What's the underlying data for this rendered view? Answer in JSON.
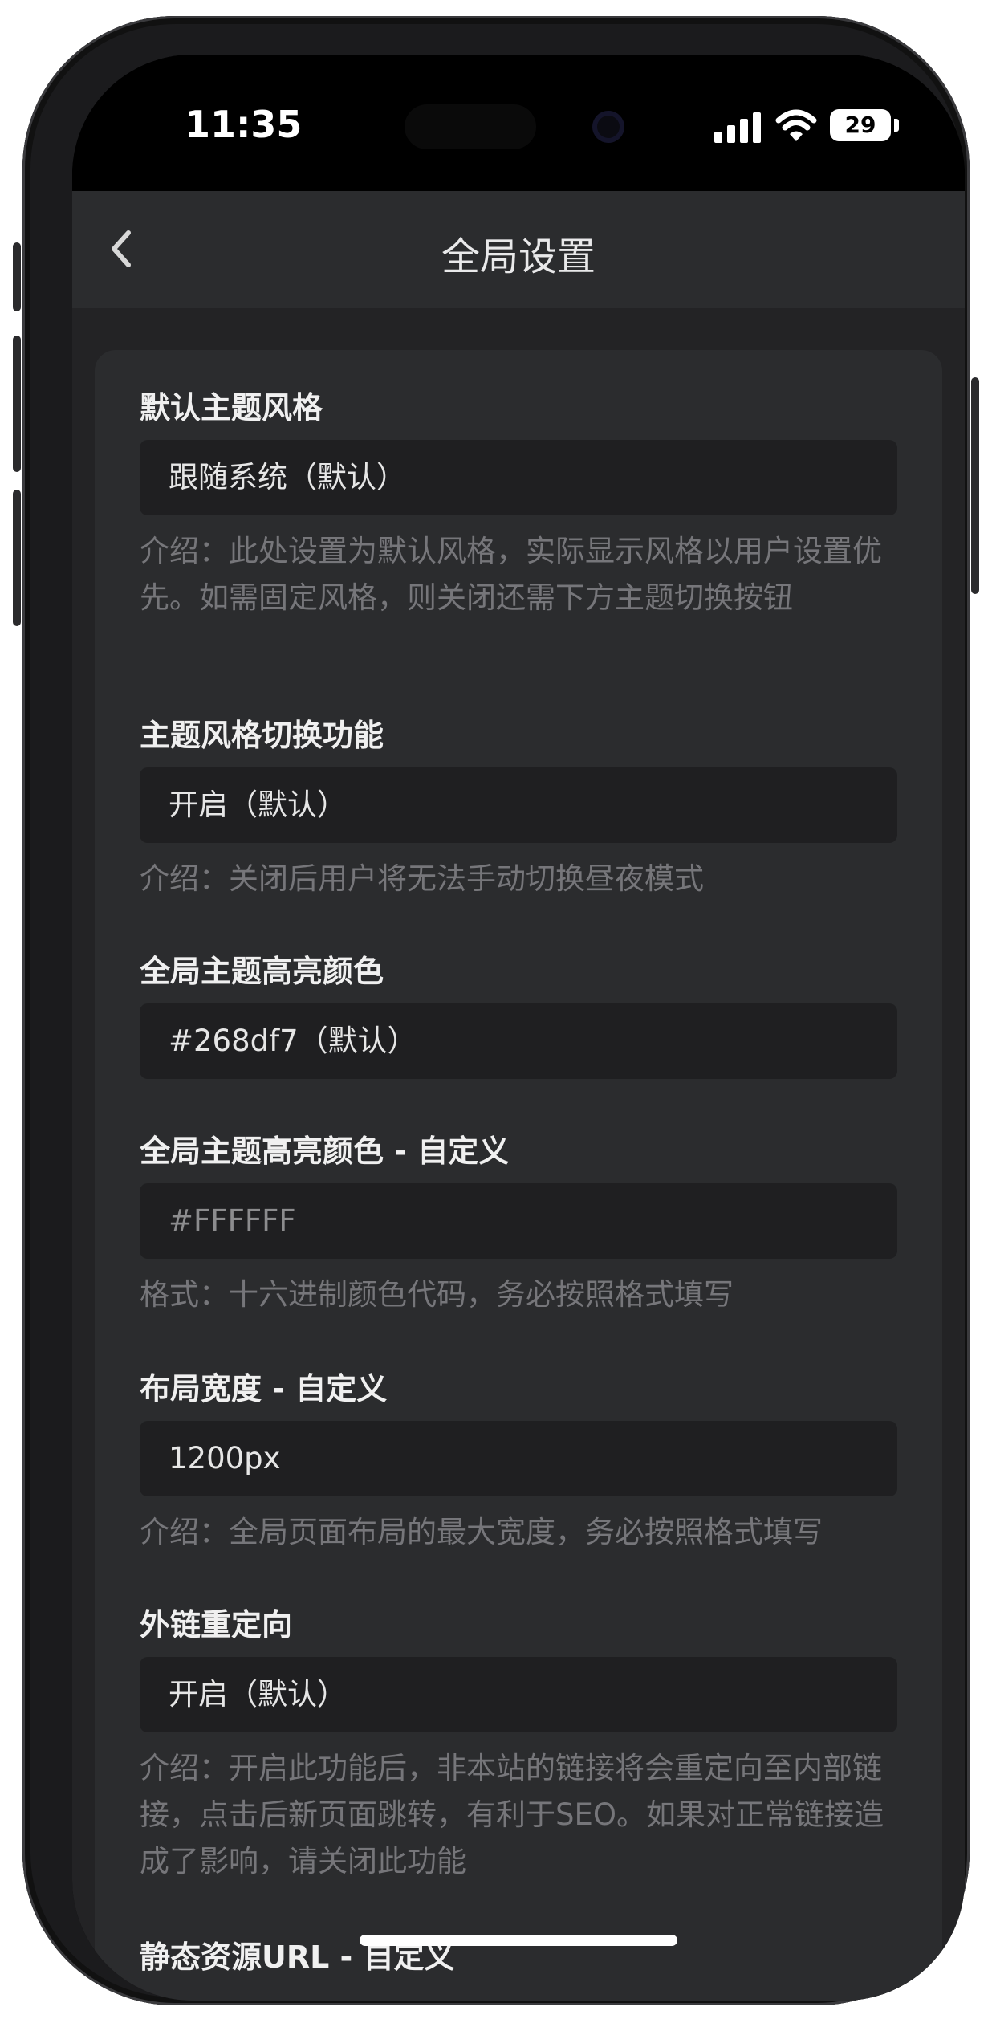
{
  "status_bar": {
    "time": "11:35",
    "battery": "29"
  },
  "header": {
    "title": "全局设置"
  },
  "settings": [
    {
      "label": "默认主题风格",
      "value": "跟随系统（默认）",
      "description": "介绍：此处设置为默认风格，实际显示风格以用户设置优先。如需固定风格，则关闭还需下方主题切换按钮"
    },
    {
      "label": "主题风格切换功能",
      "value": "开启（默认）",
      "description": "介绍：关闭后用户将无法手动切换昼夜模式"
    },
    {
      "label": "全局主题高亮颜色",
      "value": "#268df7（默认）"
    },
    {
      "label": "全局主题高亮颜色 - 自定义",
      "placeholder": "#FFFFFF",
      "description": "格式：十六进制颜色代码，务必按照格式填写"
    },
    {
      "label": "布局宽度 - 自定义",
      "value": "1200px",
      "description": "介绍：全局页面布局的最大宽度，务必按照格式填写"
    },
    {
      "label": "外链重定向",
      "value": "开启（默认）",
      "description": "介绍：开启此功能后，非本站的链接将会重定向至内部链接，点击后新页面跳转，有利于SEO。如果对正常链接造成了影响，请关闭此功能"
    },
    {
      "label": "静态资源URL - 自定义"
    }
  ],
  "icons": {
    "back": "chevron-left-icon",
    "signal": "cellular-signal-icon",
    "wifi": "wifi-icon",
    "battery": "battery-icon"
  }
}
